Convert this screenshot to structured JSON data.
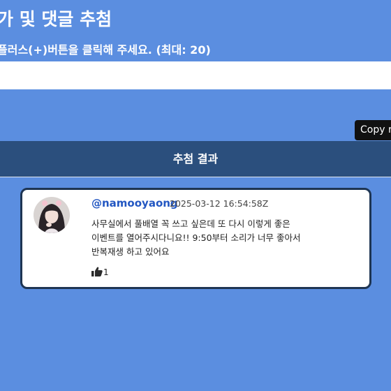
{
  "header": {
    "title": "가 및 댓글 추첨",
    "instruction": "플러스(+)버튼을 클릭해 주세요. (최대: 20)"
  },
  "input": {
    "value": ""
  },
  "copy_button": {
    "label": "Copy r"
  },
  "results": {
    "header_label": "추첨 결과",
    "comments": [
      {
        "username": "@namooyaong",
        "timestamp": "2025-03-12 16:54:58Z",
        "text_lines": [
          "사무실에서 풀배열 꼭 쓰고 싶은데 또 다시 이렇게 좋은",
          "이벤트를 열어주시다니요!! 9:50부터 소리가 너무 좋아서",
          "반복재생 하고 있어요"
        ],
        "likes": "1",
        "like_icon": "thumbs-up-icon"
      }
    ]
  },
  "colors": {
    "background": "#5b8ee0",
    "result_header": "#2b4f7d",
    "card_border": "#1e3553",
    "username": "#2357c2"
  }
}
